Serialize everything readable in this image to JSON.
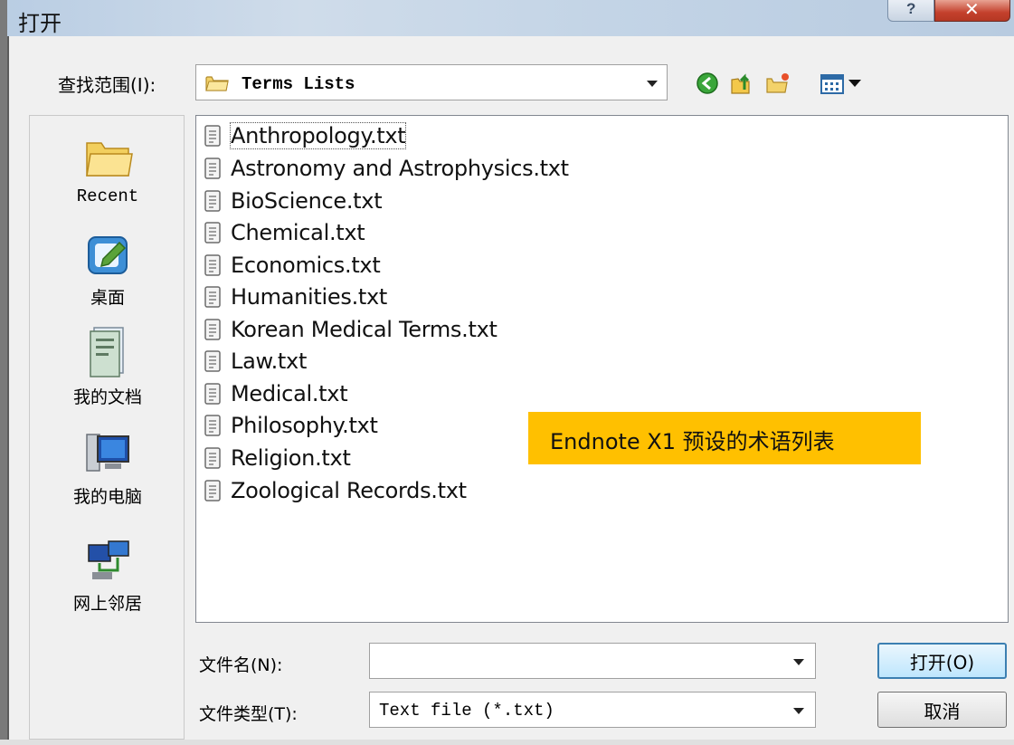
{
  "window": {
    "title": "打开",
    "help_icon": "question-icon",
    "close_icon": "close-icon"
  },
  "lookin": {
    "label": "查找范围(I):",
    "value": "Terms Lists"
  },
  "toolbar": {
    "icons": [
      "back-arrow-icon",
      "up-folder-icon",
      "new-folder-icon",
      "views-menu-icon"
    ]
  },
  "places": [
    {
      "label": "Recent",
      "icon": "recent-folder-icon"
    },
    {
      "label": "桌面",
      "icon": "desktop-icon"
    },
    {
      "label": "我的文档",
      "icon": "documents-icon"
    },
    {
      "label": "我的电脑",
      "icon": "computer-icon"
    },
    {
      "label": "网上邻居",
      "icon": "network-icon"
    }
  ],
  "files": [
    "Anthropology.txt",
    "Astronomy and Astrophysics.txt",
    "BioScience.txt",
    "Chemical.txt",
    "Economics.txt",
    "Humanities.txt",
    "Korean Medical Terms.txt",
    "Law.txt",
    "Medical.txt",
    "Philosophy.txt",
    "Religion.txt",
    "Zoological Records.txt"
  ],
  "annotation": "Endnote X1 预设的术语列表",
  "filename": {
    "label": "文件名(N):",
    "value": ""
  },
  "filetype": {
    "label": "文件类型(T):",
    "value": "Text file (*.txt)"
  },
  "buttons": {
    "open": "打开(O)",
    "cancel": "取消"
  },
  "colors": {
    "annotation_bg": "#ffc000",
    "titlebar": "#c3d4e6"
  }
}
